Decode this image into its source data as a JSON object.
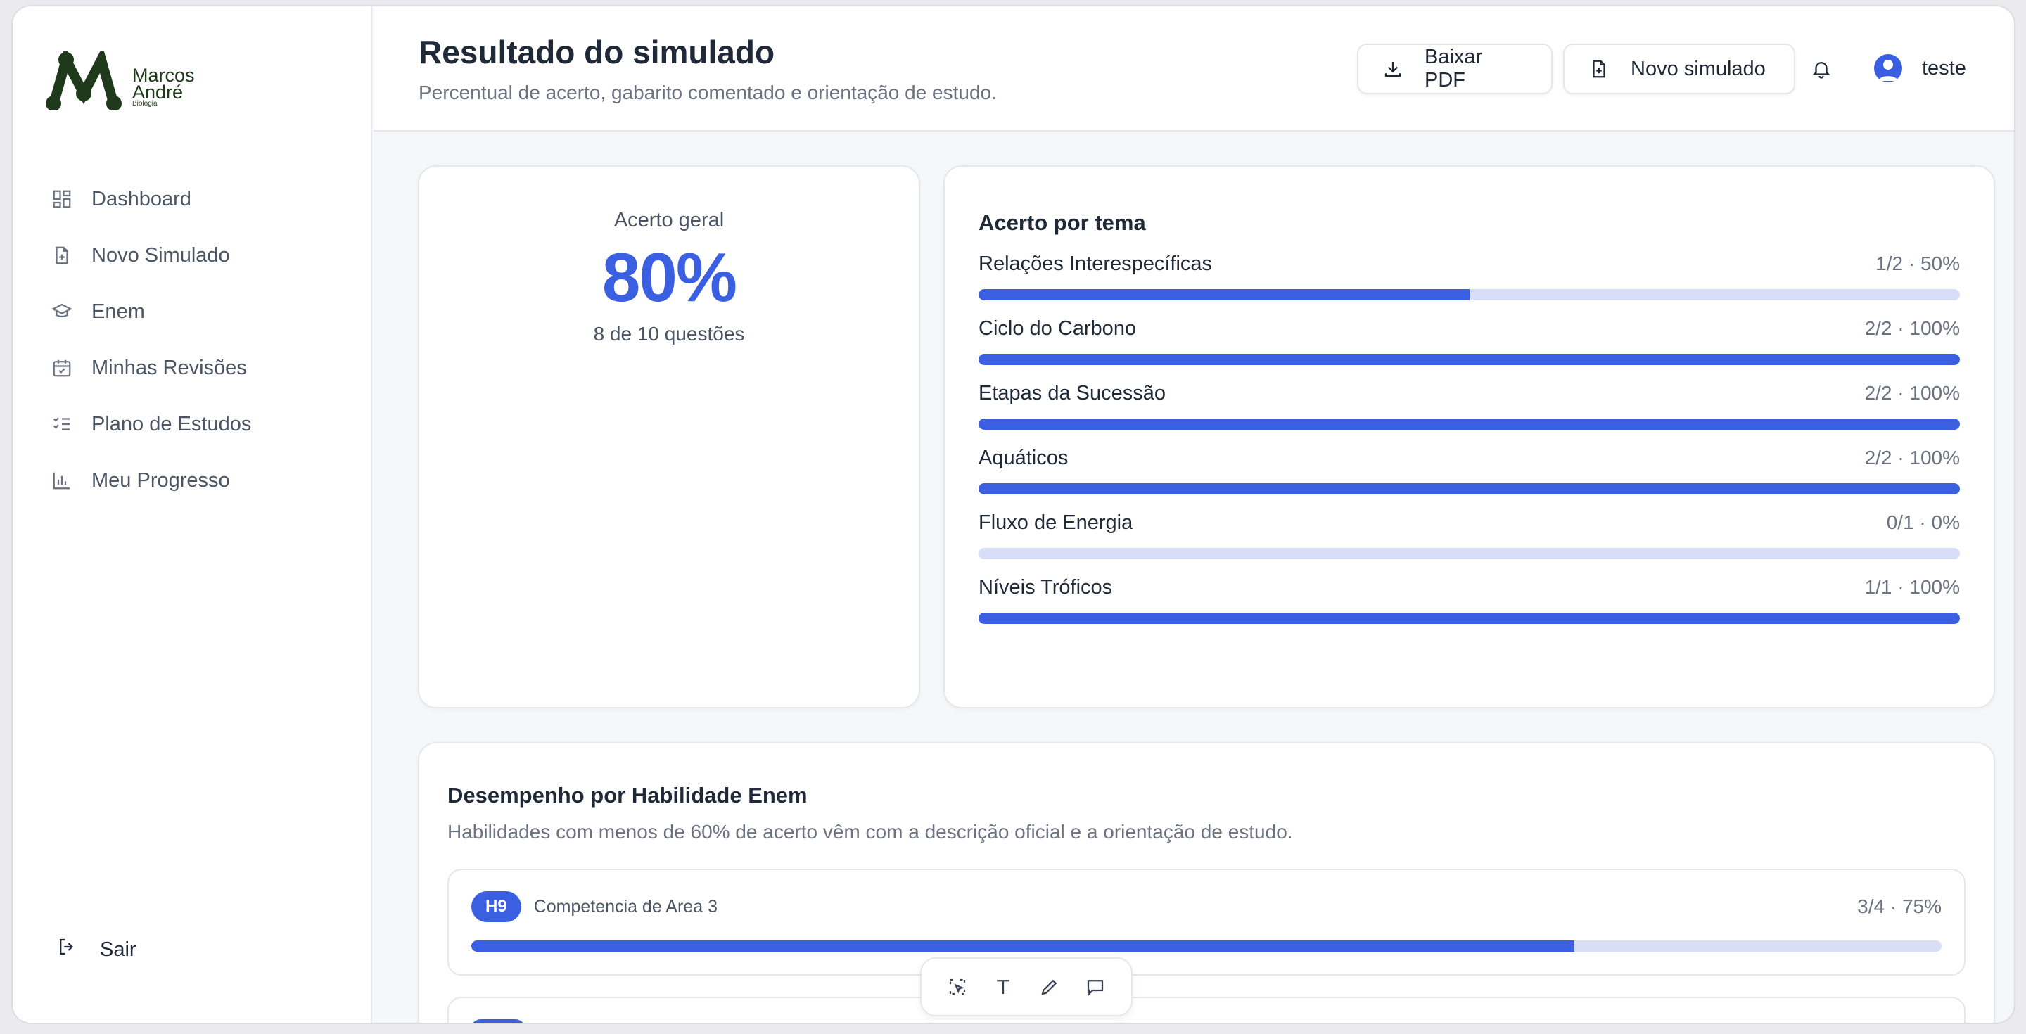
{
  "brand": {
    "line1": "Marcos",
    "line2": "André",
    "line3": "Biologia"
  },
  "sidebar": {
    "items": [
      {
        "label": "Dashboard",
        "icon": "dashboard-icon"
      },
      {
        "label": "Novo Simulado",
        "icon": "file-plus-icon"
      },
      {
        "label": "Enem",
        "icon": "graduation-cap-icon"
      },
      {
        "label": "Minhas Revisões",
        "icon": "calendar-check-icon"
      },
      {
        "label": "Plano de Estudos",
        "icon": "list-checks-icon"
      },
      {
        "label": "Meu Progresso",
        "icon": "bar-chart-icon"
      }
    ],
    "logout": "Sair"
  },
  "header": {
    "title": "Resultado do simulado",
    "subtitle": "Percentual de acerto, gabarito comentado e orientação de estudo.",
    "download_label": "Baixar PDF",
    "new_label": "Novo simulado",
    "user_name": "teste"
  },
  "score": {
    "label": "Acerto geral",
    "value": "80%",
    "detail": "8 de 10 questões"
  },
  "topics": {
    "title": "Acerto por tema",
    "items": [
      {
        "name": "Relações Interespecíficas",
        "value": "1/2 · 50%",
        "pct": 50
      },
      {
        "name": "Ciclo do Carbono",
        "value": "2/2 · 100%",
        "pct": 100
      },
      {
        "name": "Etapas da Sucessão",
        "value": "2/2 · 100%",
        "pct": 100
      },
      {
        "name": "Aquáticos",
        "value": "2/2 · 100%",
        "pct": 100
      },
      {
        "name": "Fluxo de Energia",
        "value": "0/1 · 0%",
        "pct": 0
      },
      {
        "name": "Níveis Tróficos",
        "value": "1/1 · 100%",
        "pct": 100
      }
    ]
  },
  "skills": {
    "title": "Desempenho por Habilidade Enem",
    "subtitle": "Habilidades com menos de 60% de acerto vêm com a descrição oficial e a orientação de estudo.",
    "items": [
      {
        "code": "H9",
        "name": "Competencia de Area 3",
        "value": "3/4 · 75%",
        "pct": 75
      }
    ]
  },
  "colors": {
    "accent": "#3a5fe0",
    "track": "#d8def7"
  }
}
